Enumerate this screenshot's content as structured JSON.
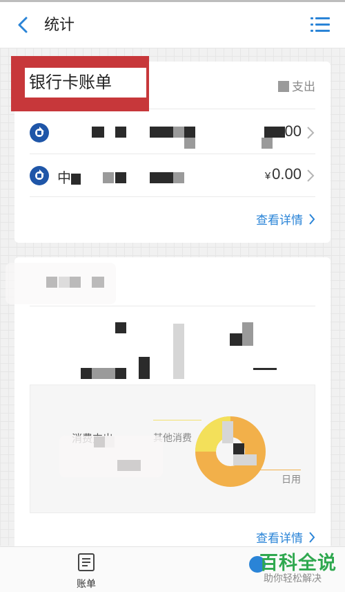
{
  "header": {
    "title": "统计"
  },
  "card1": {
    "title": "银行卡账单",
    "type_label": "支出",
    "rows": [
      {
        "bank_prefix": "",
        "amount": ".00"
      },
      {
        "bank_prefix": "中",
        "currency": "¥",
        "amount": "0.00"
      }
    ],
    "detail_link": "查看详情"
  },
  "card2": {
    "legend_consume": "消费支出",
    "legend_other": "其他消费",
    "legend_daily": "日用",
    "detail_link": "查看详情"
  },
  "tabbar": {
    "bill_label": "账单"
  },
  "watermark": {
    "title": "百科全说",
    "subtitle": "助你轻松解决"
  },
  "colors": {
    "accent": "#2a84d7",
    "highlight_box": "#c7373a",
    "chart_orange": "#f2b04a",
    "chart_yellow": "#f3e05a",
    "watermark": "#2fa84f"
  }
}
